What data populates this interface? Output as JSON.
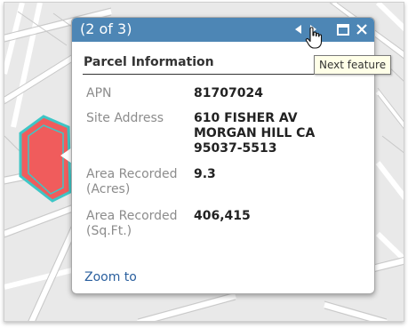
{
  "popup": {
    "counter": "(2 of 3)",
    "title": "Parcel Information",
    "fields": [
      {
        "label": "APN",
        "value": "81707024"
      },
      {
        "label": "Site Address",
        "value": "610 FISHER AV\nMORGAN HILL CA\n95037-5513"
      },
      {
        "label": "Area Recorded\n(Acres)",
        "value": "9.3"
      },
      {
        "label": "Area Recorded\n(Sq.Ft.)",
        "value": "406,415"
      }
    ],
    "zoom_link": "Zoom to",
    "buttons": {
      "prev": "◀",
      "next": "▶",
      "maximize": "☐",
      "close": "✕"
    }
  },
  "tooltip": "Next feature",
  "colors": {
    "titlebar": "#4d86b5",
    "parcel_fill": "#f05c5c",
    "parcel_outline": "#3ec6c6",
    "link": "#2a5f9e"
  },
  "icons": {
    "prev": "triangle-left-icon",
    "next": "triangle-right-icon",
    "maximize": "square-icon",
    "close": "x-icon",
    "cursor": "hand-pointer-icon"
  }
}
